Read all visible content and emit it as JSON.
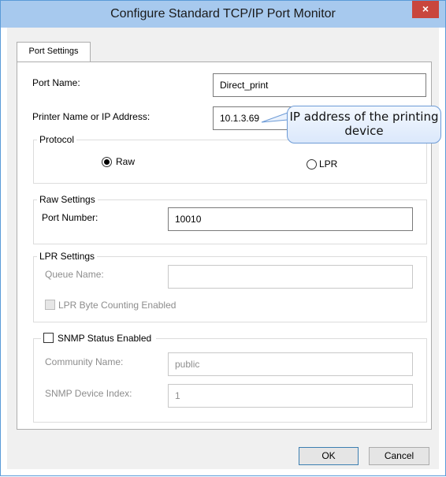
{
  "window": {
    "title": "Configure Standard TCP/IP Port Monitor",
    "close_label": "×"
  },
  "tabs": [
    {
      "label": "Port Settings"
    }
  ],
  "port_name": {
    "label": "Port Name:",
    "value": "Direct_print"
  },
  "printer_address": {
    "label": "Printer Name or IP Address:",
    "value": "10.1.3.69"
  },
  "callout": {
    "line1": "IP address of the printing",
    "line2": "device"
  },
  "protocol": {
    "group_label": "Protocol",
    "options": [
      {
        "label": "Raw",
        "selected": true
      },
      {
        "label": "LPR",
        "selected": false
      }
    ]
  },
  "raw_settings": {
    "group_label": "Raw Settings",
    "port_number_label": "Port Number:",
    "port_number_value": "10010"
  },
  "lpr_settings": {
    "group_label": "LPR Settings",
    "queue_name_label": "Queue Name:",
    "queue_name_value": "",
    "byte_counting_label": "LPR Byte Counting Enabled",
    "byte_counting_checked": false
  },
  "snmp": {
    "enabled_label": "SNMP Status Enabled",
    "enabled_checked": false,
    "community_label": "Community Name:",
    "community_value": "public",
    "device_index_label": "SNMP Device Index:",
    "device_index_value": "1"
  },
  "buttons": {
    "ok": "OK",
    "cancel": "Cancel"
  },
  "colors": {
    "titlebar": "#a7c9ee",
    "close": "#c9463d",
    "disabled_text": "#8d8d8d"
  }
}
